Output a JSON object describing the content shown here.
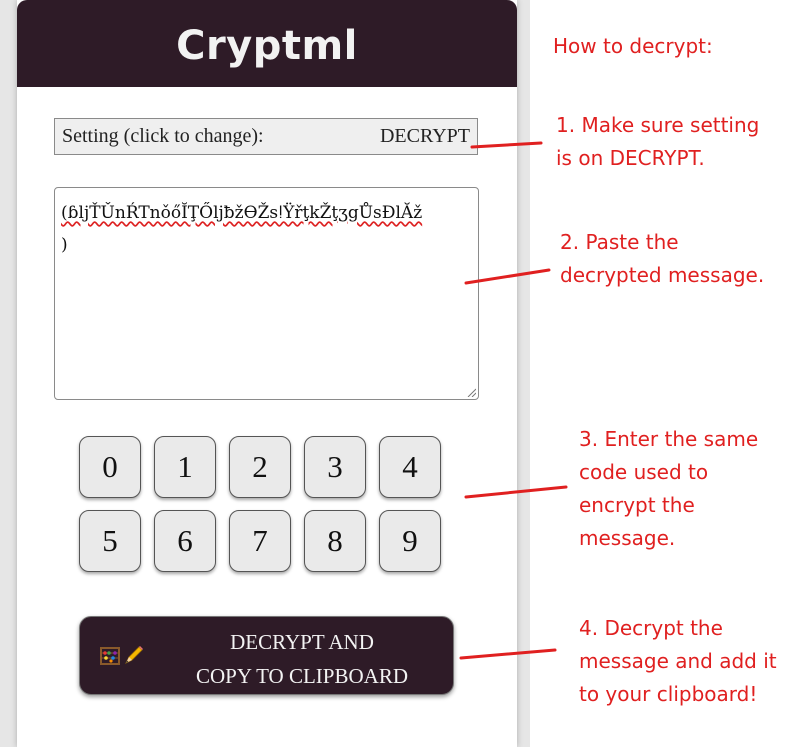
{
  "app": {
    "title": "Cryptml"
  },
  "setting": {
    "label": "Setting (click to change):",
    "value": "DECRYPT"
  },
  "message": {
    "line1": "(ɓljŤǓnŔTnǒőĬŢŐljƀžƟŽsǃŸřţkŽţʒgŮsĐlĂž",
    "line2": ")"
  },
  "keypad": {
    "keys": [
      "0",
      "1",
      "2",
      "3",
      "4",
      "5",
      "6",
      "7",
      "8",
      "9"
    ]
  },
  "action": {
    "line1": "DECRYPT AND",
    "line2": "COPY TO CLIPBOARD",
    "icons": [
      "abacus-icon",
      "pencil-icon"
    ]
  },
  "instructions": {
    "heading": "How to decrypt:",
    "step1": [
      "1. Make sure setting",
      "is on DECRYPT."
    ],
    "step2": [
      "2. Paste the",
      "decrypted message."
    ],
    "step3": [
      "3. Enter the same",
      "code used to",
      "encrypt the",
      "message."
    ],
    "step4": [
      "4. Decrypt the",
      "message and add it",
      "to your clipboard!"
    ]
  },
  "colors": {
    "brand": "#2e1b27",
    "annotation": "#e02020",
    "key_background": "#eaeaea"
  }
}
